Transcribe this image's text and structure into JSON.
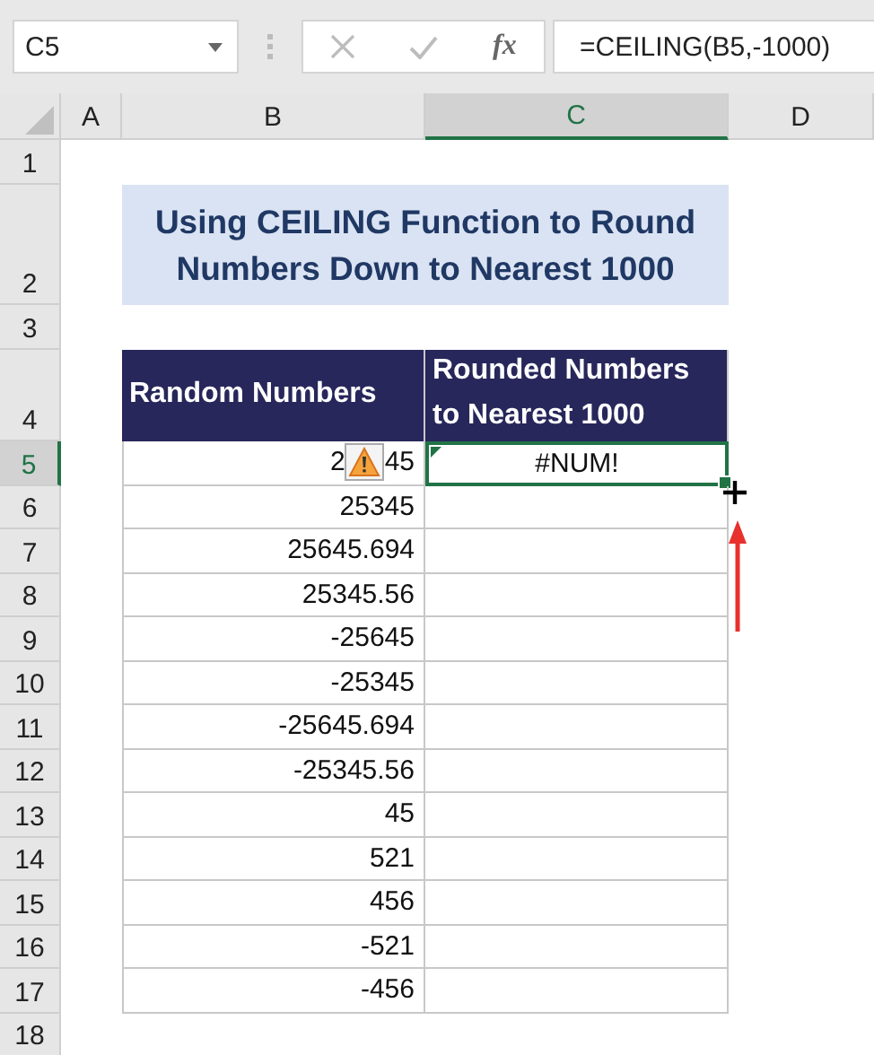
{
  "name_box": {
    "value": "C5"
  },
  "formula_bar": {
    "fx": "fx",
    "value": "=CEILING(B5,-1000)"
  },
  "columns": [
    {
      "label": "A",
      "selected": false
    },
    {
      "label": "B",
      "selected": false
    },
    {
      "label": "C",
      "selected": true
    },
    {
      "label": "D",
      "selected": false
    }
  ],
  "row_numbers": [
    {
      "label": "1",
      "selected": false
    },
    {
      "label": "2",
      "selected": false
    },
    {
      "label": "3",
      "selected": false
    },
    {
      "label": "4",
      "selected": false
    },
    {
      "label": "5",
      "selected": true
    },
    {
      "label": "6",
      "selected": false
    },
    {
      "label": "7",
      "selected": false
    },
    {
      "label": "8",
      "selected": false
    },
    {
      "label": "9",
      "selected": false
    },
    {
      "label": "10",
      "selected": false
    },
    {
      "label": "11",
      "selected": false
    },
    {
      "label": "12",
      "selected": false
    },
    {
      "label": "13",
      "selected": false
    },
    {
      "label": "14",
      "selected": false
    },
    {
      "label": "15",
      "selected": false
    },
    {
      "label": "16",
      "selected": false
    },
    {
      "label": "17",
      "selected": false
    },
    {
      "label": "18",
      "selected": false
    }
  ],
  "title_lines": [
    "Using CEILING Function to Round",
    "Numbers Down to Nearest 1000"
  ],
  "table": {
    "headers": [
      "Random Numbers",
      "Rounded Numbers to Nearest 1000"
    ],
    "rows": [
      {
        "random_parts": [
          "2",
          "45"
        ],
        "warning": true,
        "rounded": "#NUM!",
        "selected": true
      },
      {
        "random_parts": [
          "25345"
        ],
        "warning": false,
        "selected": false
      },
      {
        "random_parts": [
          "25645.694"
        ],
        "warning": false,
        "selected": false
      },
      {
        "random_parts": [
          "25345.56"
        ],
        "warning": false,
        "selected": false
      },
      {
        "random_parts": [
          "-25645"
        ],
        "warning": false,
        "selected": false
      },
      {
        "random_parts": [
          "-25345"
        ],
        "warning": false,
        "selected": false
      },
      {
        "random_parts": [
          "-25645.694"
        ],
        "warning": false,
        "selected": false
      },
      {
        "random_parts": [
          "-25345.56"
        ],
        "warning": false,
        "selected": false
      },
      {
        "random_parts": [
          "45"
        ],
        "warning": false,
        "selected": false
      },
      {
        "random_parts": [
          "521"
        ],
        "warning": false,
        "selected": false
      },
      {
        "random_parts": [
          "456"
        ],
        "warning": false,
        "selected": false
      },
      {
        "random_parts": [
          "-521"
        ],
        "warning": false,
        "selected": false
      },
      {
        "random_parts": [
          "-456"
        ],
        "warning": false,
        "selected": false
      }
    ]
  }
}
